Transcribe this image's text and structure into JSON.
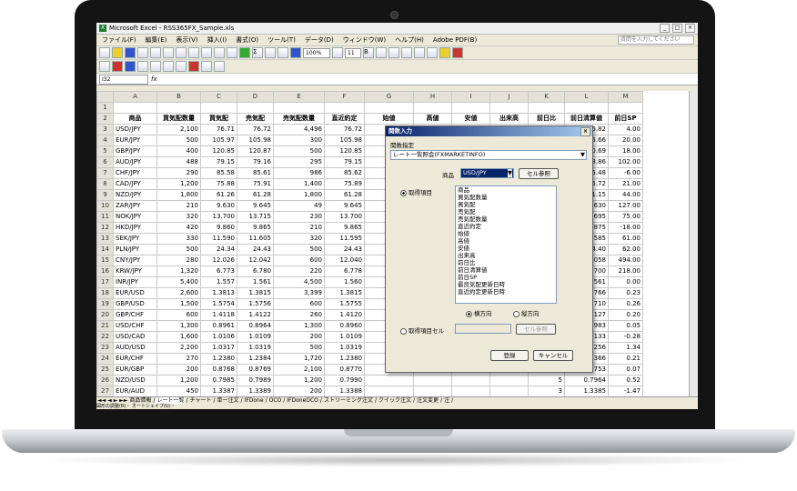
{
  "window": {
    "title": "Microsoft Excel - RSS365FX_Sample.xls"
  },
  "menu": [
    "ファイル(F)",
    "編集(E)",
    "表示(V)",
    "挿入(I)",
    "書式(O)",
    "ツール(T)",
    "データ(D)",
    "ウィンドウ(W)",
    "ヘルプ(H)",
    "Adobe PDF(B)"
  ],
  "help_placeholder": "質問を入力してください",
  "toolbar": {
    "zoom": "100%",
    "font_size": "11"
  },
  "formula_bar": {
    "name_box": "I32",
    "fx": "fx"
  },
  "columns": [
    "",
    "A",
    "B",
    "C",
    "D",
    "E",
    "F",
    "G",
    "H",
    "I",
    "J",
    "K",
    "L",
    "M"
  ],
  "header_row": [
    "商品",
    "買気配数量",
    "買気配",
    "売気配",
    "売気配数量",
    "直近約定",
    "始値",
    "高値",
    "安値",
    "出来高",
    "前日比",
    "前日清算値",
    "前日SP"
  ],
  "rows": [
    [
      "3",
      "USD/JPY",
      "2,100",
      "76.71",
      "76.72",
      "4,496",
      "76.72",
      "",
      "",
      "",
      "",
      "0",
      "76.82",
      "4.00"
    ],
    [
      "4",
      "EUR/JPY",
      "500",
      "105.97",
      "105.98",
      "300",
      "105.98",
      "",
      "",
      "",
      "",
      "2",
      "105.66",
      "20.00"
    ],
    [
      "5",
      "GBP/JPY",
      "400",
      "120.85",
      "120.87",
      "500",
      "120.85",
      "",
      "",
      "",
      "",
      "6",
      "120.69",
      "18.00"
    ],
    [
      "6",
      "AUD/JPY",
      "488",
      "79.15",
      "79.16",
      "295",
      "79.15",
      "",
      "",
      "",
      "",
      "9",
      "78.86",
      "102.00"
    ],
    [
      "7",
      "CHF/JPY",
      "290",
      "85.58",
      "85.61",
      "986",
      "85.62",
      "",
      "",
      "",
      "",
      "7",
      "85.48",
      "-6.00"
    ],
    [
      "8",
      "CAD/JPY",
      "1,200",
      "75.88",
      "75.91",
      "1,400",
      "75.89",
      "",
      "",
      "",
      "",
      "4",
      "75.72",
      "21.00"
    ],
    [
      "9",
      "NZD/JPY",
      "1,800",
      "61.26",
      "61.28",
      "1,800",
      "61.28",
      "",
      "",
      "",
      "",
      "1",
      "61.15",
      "44.00"
    ],
    [
      "10",
      "ZAR/JPY",
      "210",
      "9.630",
      "9.645",
      "49",
      "9.645",
      "",
      "",
      "",
      "",
      "5",
      "9.630",
      "127.00"
    ],
    [
      "11",
      "NOK/JPY",
      "320",
      "13.700",
      "13.715",
      "230",
      "13.700",
      "",
      "",
      "",
      "",
      "5",
      "13.695",
      "75.00"
    ],
    [
      "12",
      "HKD/JPY",
      "420",
      "9.860",
      "9.865",
      "210",
      "9.865",
      "",
      "",
      "",
      "",
      "9",
      "9.875",
      "-18.00"
    ],
    [
      "13",
      "SEK/JPY",
      "330",
      "11.590",
      "11.605",
      "320",
      "11.595",
      "",
      "",
      "",
      "",
      "0",
      "11.585",
      "61.00"
    ],
    [
      "14",
      "PLN/JPY",
      "500",
      "24.34",
      "24.43",
      "500",
      "24.43",
      "",
      "",
      "",
      "",
      "3",
      "24.40",
      "62.00"
    ],
    [
      "15",
      "CNY/JPY",
      "280",
      "12.026",
      "12.042",
      "600",
      "12.040",
      "",
      "",
      "",
      "",
      "8",
      "12.058",
      "494.00"
    ],
    [
      "16",
      "KRW/JPY",
      "1,320",
      "6.773",
      "6.780",
      "220",
      "6.778",
      "",
      "",
      "",
      "",
      "8",
      "6.700",
      "218.00"
    ],
    [
      "17",
      "INR/JPY",
      "5,400",
      "1.557",
      "1.561",
      "4,500",
      "1.560",
      "",
      "",
      "",
      "",
      "0",
      "1.561",
      "0.00"
    ],
    [
      "18",
      "EUR/USD",
      "2,600",
      "1.3813",
      "1.3815",
      "3,399",
      "1.3815",
      "",
      "",
      "",
      "",
      "9",
      "1.3766",
      "0.23"
    ],
    [
      "19",
      "GBP/USD",
      "1,500",
      "1.5754",
      "1.5756",
      "600",
      "1.5755",
      "",
      "",
      "",
      "",
      "1",
      "1.5710",
      "0.26"
    ],
    [
      "20",
      "GBP/CHF",
      "600",
      "1.4118",
      "1.4122",
      "260",
      "1.4120",
      "",
      "",
      "",
      "",
      "3",
      "1.4127",
      "0.20"
    ],
    [
      "21",
      "USD/CHF",
      "1,300",
      "0.8961",
      "0.8964",
      "1,300",
      "0.8960",
      "",
      "",
      "",
      "",
      "3",
      "0.8983",
      "0.05"
    ],
    [
      "22",
      "USD/CAD",
      "1,600",
      "1.0106",
      "1.0109",
      "200",
      "1.0109",
      "",
      "",
      "",
      "",
      "3",
      "1.0133",
      "-0.28"
    ],
    [
      "23",
      "AUD/USD",
      "2,200",
      "1.0317",
      "1.0319",
      "500",
      "1.0319",
      "",
      "",
      "",
      "",
      "5",
      "1.0256",
      "1.34"
    ],
    [
      "24",
      "EUR/CHF",
      "270",
      "1.2380",
      "1.2384",
      "1,720",
      "1.2380",
      "",
      "",
      "",
      "",
      "3",
      "1.2366",
      "0.21"
    ],
    [
      "25",
      "EUR/GBP",
      "200",
      "0.8768",
      "0.8769",
      "2,100",
      "0.8770",
      "",
      "",
      "",
      "",
      "3",
      "0.8753",
      "0.07"
    ],
    [
      "26",
      "NZD/USD",
      "1,200",
      "0.7985",
      "0.7989",
      "1,200",
      "0.7990",
      "",
      "",
      "",
      "",
      "5",
      "0.7964",
      "0.52"
    ],
    [
      "27",
      "EUR/AUD",
      "450",
      "1.3387",
      "1.3389",
      "200",
      "1.3388",
      "",
      "",
      "",
      "",
      "3",
      "1.3385",
      "-1.47"
    ],
    [
      "28",
      "GBP/AUD",
      "130",
      "1.5267",
      "1.5271",
      "200",
      "1.5270",
      "",
      "",
      "",
      "",
      "0",
      "1.5292",
      "-1.75"
    ]
  ],
  "sheet_tabs": [
    "商品情報",
    "レート一覧",
    "チャート",
    "単一注文",
    "IFDone",
    "OCO",
    "IFDoneOCO",
    "ストリーミング注文",
    "クイック注文",
    "注文変更",
    "注"
  ],
  "draw_bar": "図形の調整(R)・  オートシェイプ(U)・",
  "dialog": {
    "title": "関数入力",
    "close": "×",
    "func_label": "関数指定",
    "func_value": "レート一覧照会(FXMARKETINFO)",
    "product_label": "商品",
    "product_value": "USD/JPY",
    "cell_ref_button": "セル参照",
    "items_label": "取得項目",
    "items": [
      "商品",
      "買気配数量",
      "買気配",
      "売気配",
      "売気配数量",
      "直近約定",
      "始値",
      "高値",
      "安値",
      "出来高",
      "前日比",
      "前日清算値",
      "前日SP",
      "最良気配更新日時",
      "直近約定更新日時"
    ],
    "horizontal": "横方向",
    "vertical": "縦方向",
    "items_cell_label": "取得項目セル",
    "cell_ref_button2": "セル参照",
    "ok": "登録",
    "cancel": "キャンセル"
  }
}
